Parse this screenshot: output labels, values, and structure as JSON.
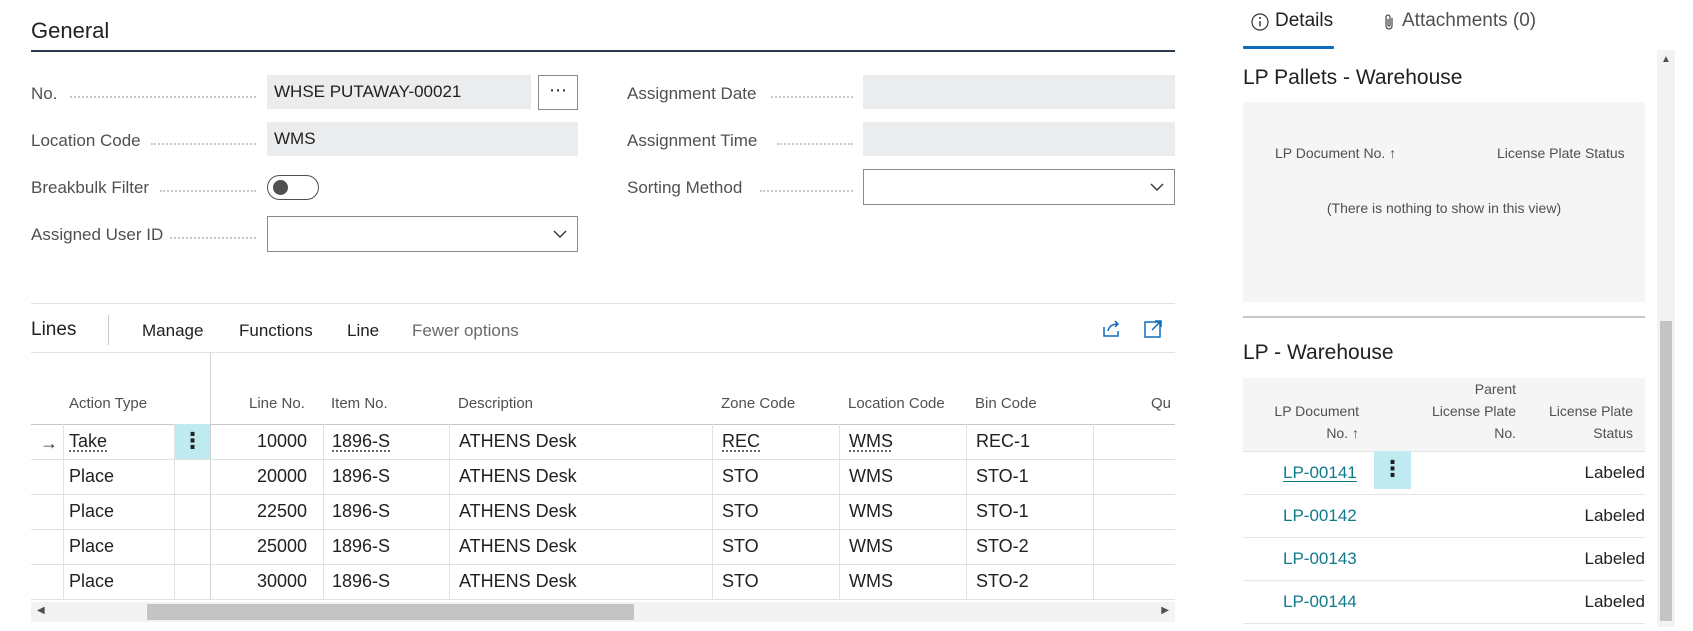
{
  "general": {
    "title": "General",
    "fields": {
      "no_label": "No.",
      "no_value": "WHSE PUTAWAY-00021",
      "assist_button": "⋯",
      "location_code_label": "Location Code",
      "location_code_value": "WMS",
      "breakbulk_filter_label": "Breakbulk Filter",
      "breakbulk_filter_on": false,
      "assigned_user_id_label": "Assigned User ID",
      "assigned_user_id_value": "",
      "assignment_date_label": "Assignment Date",
      "assignment_date_value": "",
      "assignment_time_label": "Assignment Time",
      "assignment_time_value": "",
      "sorting_method_label": "Sorting Method",
      "sorting_method_value": ""
    }
  },
  "lines": {
    "title": "Lines",
    "actions": [
      "Manage",
      "Functions",
      "Line",
      "Fewer options"
    ],
    "icons": [
      "share-icon",
      "open-in-new-window-icon"
    ],
    "columns": [
      "Action Type",
      "Line No.",
      "Item No.",
      "Description",
      "Zone Code",
      "Location Code",
      "Bin Code",
      "Qu"
    ],
    "rows": [
      {
        "action_type": "Take",
        "line_no": "10000",
        "item_no": "1896-S",
        "description": "ATHENS Desk",
        "zone_code": "REC",
        "location_code": "WMS",
        "bin_code": "REC-1"
      },
      {
        "action_type": "Place",
        "line_no": "20000",
        "item_no": "1896-S",
        "description": "ATHENS Desk",
        "zone_code": "STO",
        "location_code": "WMS",
        "bin_code": "STO-1"
      },
      {
        "action_type": "Place",
        "line_no": "22500",
        "item_no": "1896-S",
        "description": "ATHENS Desk",
        "zone_code": "STO",
        "location_code": "WMS",
        "bin_code": "STO-1"
      },
      {
        "action_type": "Place",
        "line_no": "25000",
        "item_no": "1896-S",
        "description": "ATHENS Desk",
        "zone_code": "STO",
        "location_code": "WMS",
        "bin_code": "STO-2"
      },
      {
        "action_type": "Place",
        "line_no": "30000",
        "item_no": "1896-S",
        "description": "ATHENS Desk",
        "zone_code": "STO",
        "location_code": "WMS",
        "bin_code": "STO-2"
      }
    ],
    "row_menu": "⋮",
    "current_row_marker": "→"
  },
  "factbox": {
    "tabs": {
      "details": "Details",
      "attachments": "Attachments (0)"
    },
    "pallets": {
      "title": "LP Pallets - Warehouse",
      "col_doc_no": "LP Document No. ↑",
      "col_status": "License Plate Status",
      "empty_text": "(There is nothing to show in this view)"
    },
    "warehouse": {
      "title": "LP - Warehouse",
      "col_doc_no_1": "LP Document",
      "col_doc_no_2": "No. ↑",
      "col_parent_1": "Parent",
      "col_parent_2": "License Plate",
      "col_parent_3": "No.",
      "col_status_1": "License Plate",
      "col_status_2": "Status",
      "rows": [
        {
          "doc_no": "LP-00141",
          "status": "Labeled"
        },
        {
          "doc_no": "LP-00142",
          "status": "Labeled"
        },
        {
          "doc_no": "LP-00143",
          "status": "Labeled"
        },
        {
          "doc_no": "LP-00144",
          "status": "Labeled"
        }
      ],
      "row_menu": "⋮"
    }
  },
  "colors": {
    "link": "#0f7a8c",
    "accent": "#0f6cbd",
    "selection": "#bfeaf0",
    "readonly_bg": "#eaecee"
  }
}
